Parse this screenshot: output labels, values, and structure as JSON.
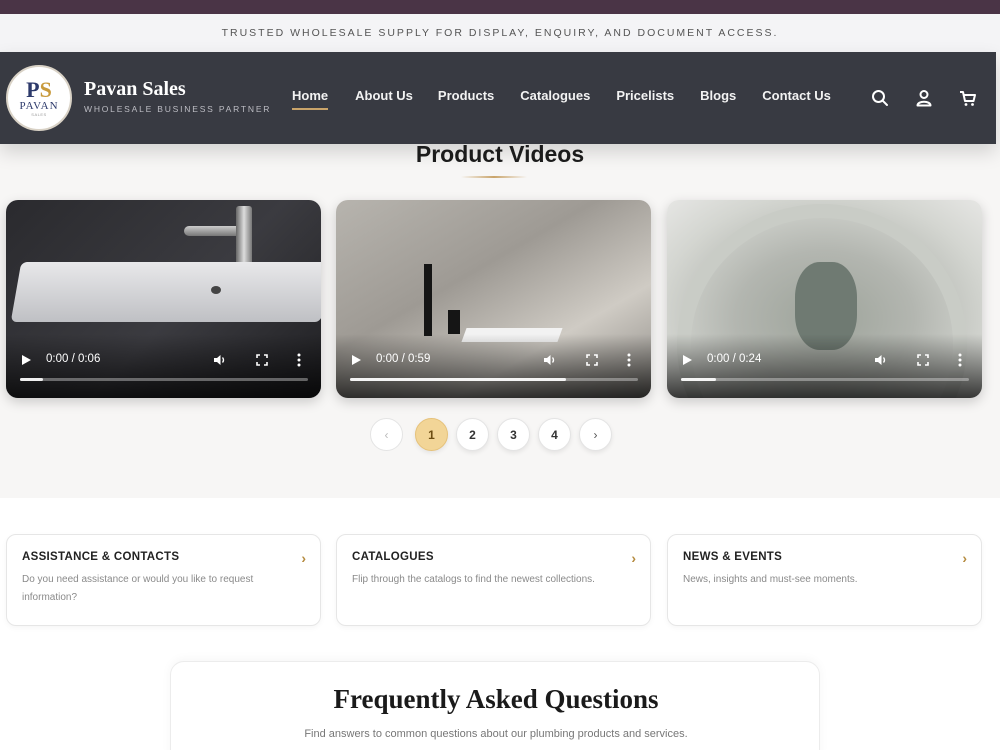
{
  "announcement": "TRUSTED WHOLESALE SUPPLY FOR DISPLAY, ENQUIRY, AND DOCUMENT ACCESS.",
  "brand": {
    "logo_mark_left": "P",
    "logo_mark_right": "S",
    "logo_word": "PAVAN",
    "logo_sub": "SALES",
    "name": "Pavan Sales",
    "tagline": "WHOLESALE BUSINESS PARTNER"
  },
  "nav": [
    {
      "label": "Home",
      "active": true
    },
    {
      "label": "About Us"
    },
    {
      "label": "Products"
    },
    {
      "label": "Catalogues"
    },
    {
      "label": "Pricelists"
    },
    {
      "label": "Blogs"
    },
    {
      "label": "Contact Us"
    }
  ],
  "header_icons": [
    "search-icon",
    "user-icon",
    "cart-icon"
  ],
  "videos_section": {
    "title": "Product Videos",
    "videos": [
      {
        "time": "0:00 / 0:06",
        "progress": 0.08
      },
      {
        "time": "0:00 / 0:59",
        "progress": 0.75
      },
      {
        "time": "0:00 / 0:24",
        "progress": 0.12
      }
    ]
  },
  "pagination": {
    "prev": "‹",
    "next": "›",
    "pages": [
      "1",
      "2",
      "3",
      "4"
    ],
    "current": "1"
  },
  "cards": [
    {
      "title": "ASSISTANCE & CONTACTS",
      "text": "Do you need assistance or would you like to request information?",
      "chevron": "›"
    },
    {
      "title": "CATALOGUES",
      "text": "Flip through the catalogs to find the newest collections.",
      "chevron": "›"
    },
    {
      "title": "NEWS & EVENTS",
      "text": "News, insights and must-see moments.",
      "chevron": "›"
    }
  ],
  "faq": {
    "title": "Frequently Asked Questions",
    "subtitle": "Find answers to common questions about our plumbing products and services."
  },
  "colors": {
    "top_strip": "#4a3446",
    "header_bg": "#383a42",
    "accent_gold": "#c9a46a",
    "active_page": "#f2d597"
  }
}
